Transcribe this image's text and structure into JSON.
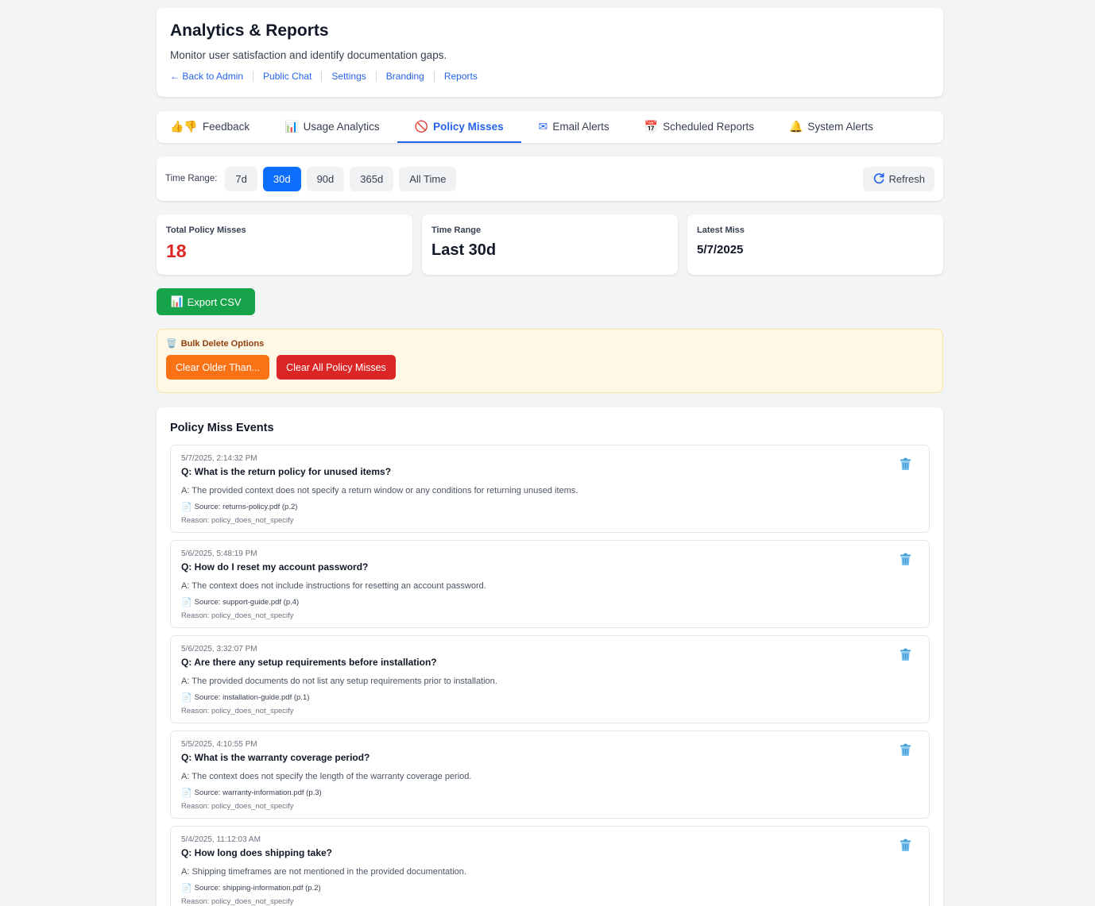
{
  "header": {
    "title": "Analytics & Reports",
    "subtitle": "Monitor user satisfaction and identify documentation gaps.",
    "links": [
      "← Back to Admin",
      "Public Chat",
      "Settings",
      "Branding",
      "Reports"
    ]
  },
  "tabs": [
    {
      "icon": "👍👎",
      "label": "Feedback"
    },
    {
      "icon": "📊",
      "label": "Usage Analytics"
    },
    {
      "icon": "🚫",
      "label": "Policy Misses"
    },
    {
      "icon": "✉",
      "label": "Email Alerts"
    },
    {
      "icon": "📅",
      "label": "Scheduled Reports"
    },
    {
      "icon": "🔔",
      "label": "System Alerts"
    }
  ],
  "active_tab": "Policy Misses",
  "time_range": {
    "label": "Time Range:",
    "options": [
      "7d",
      "30d",
      "90d",
      "365d",
      "All Time"
    ],
    "selected": "30d",
    "refresh_label": "Refresh"
  },
  "stats": {
    "total_label": "Total Policy Misses",
    "total_value": "18",
    "range_label": "Time Range",
    "range_value": "Last 30d",
    "latest_label": "Latest Miss",
    "latest_value": "5/7/2025"
  },
  "export": {
    "icon": "📊",
    "label": "Export CSV"
  },
  "bulk": {
    "icon": "🗑️",
    "title": "Bulk Delete Options",
    "clear_older": "Clear Older Than...",
    "clear_all": "Clear All Policy Misses"
  },
  "events": {
    "title": "Policy Miss Events",
    "items": [
      {
        "timestamp": "5/7/2025, 2:14:32 PM",
        "question": "Q: What is the return policy for unused items?",
        "answer": "A: The provided context does not specify a return window or any conditions for returning unused items.",
        "source": "Source: returns-policy.pdf (p.2)",
        "reason": "Reason: policy_does_not_specify"
      },
      {
        "timestamp": "5/6/2025, 5:48:19 PM",
        "question": "Q: How do I reset my account password?",
        "answer": "A: The context does not include instructions for resetting an account password.",
        "source": "Source: support-guide.pdf (p.4)",
        "reason": "Reason: policy_does_not_specify"
      },
      {
        "timestamp": "5/6/2025, 3:32:07 PM",
        "question": "Q: Are there any setup requirements before installation?",
        "answer": "A: The provided documents do not list any setup requirements prior to installation.",
        "source": "Source: installation-guide.pdf (p.1)",
        "reason": "Reason: policy_does_not_specify"
      },
      {
        "timestamp": "5/5/2025, 4:10:55 PM",
        "question": "Q: What is the warranty coverage period?",
        "answer": "A: The context does not specify the length of the warranty coverage period.",
        "source": "Source: warranty-information.pdf (p.3)",
        "reason": "Reason: policy_does_not_specify"
      },
      {
        "timestamp": "5/4/2025, 11:12:03 AM",
        "question": "Q: How long does shipping take?",
        "answer": "A: Shipping timeframes are not mentioned in the provided documentation.",
        "source": "Source: shipping-information.pdf (p.2)",
        "reason": "Reason: policy_does_not_specify"
      }
    ]
  },
  "colors": {
    "accent": "#2563eb",
    "selected_range": "#0d6efd",
    "danger": "#dc2626",
    "export_green": "#16a34a",
    "warning_orange": "#f97316",
    "bulk_bg": "#fff8e6"
  }
}
